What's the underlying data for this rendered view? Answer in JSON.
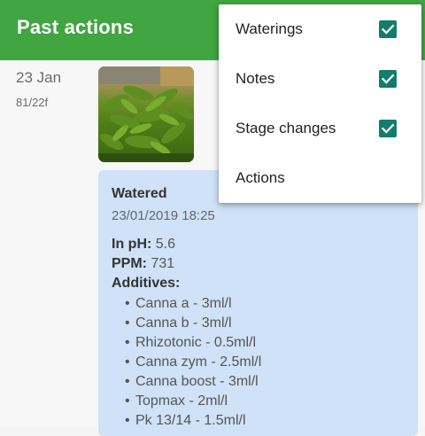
{
  "appbar": {
    "title": "Past actions"
  },
  "entry": {
    "date": "23 Jan",
    "day": "81/22f",
    "photo_icon": "cannabis-plant-photo",
    "card": {
      "title": "Watered",
      "timestamp": "23/01/2019 18:25",
      "ph_label": "In pH:",
      "ph_value": "5.6",
      "ppm_label": "PPM:",
      "ppm_value": "731",
      "additives_label": "Additives:",
      "additives": [
        "Canna a - 3ml/l",
        "Canna b - 3ml/l",
        "Rhizotonic - 0.5ml/l",
        "Canna zym - 2.5ml/l",
        "Canna boost - 3ml/l",
        "Topmax - 2ml/l",
        "Pk 13/14 - 1.5ml/l"
      ]
    }
  },
  "filter_menu": {
    "items": [
      {
        "label": "Waterings",
        "checked": true
      },
      {
        "label": "Notes",
        "checked": true
      },
      {
        "label": "Stage changes",
        "checked": true
      },
      {
        "label": "Actions",
        "checked": false
      }
    ]
  },
  "colors": {
    "appbar": "#41a541",
    "card": "#cfe2f7",
    "checkbox": "#147c6e"
  }
}
